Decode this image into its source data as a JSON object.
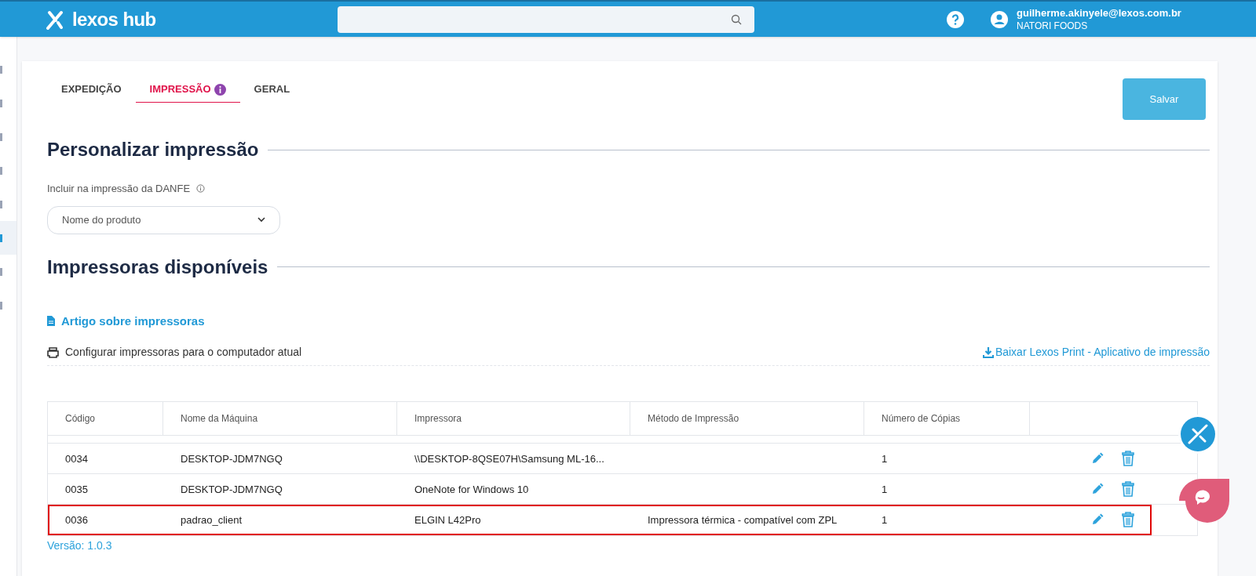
{
  "header": {
    "logo": "lexos hub",
    "user": {
      "email": "guilherme.akinyele@lexos.com.br",
      "company": "NATORI FOODS"
    }
  },
  "sidebar": {
    "items": [
      {
        "selected": false
      },
      {
        "selected": false
      },
      {
        "selected": false
      },
      {
        "selected": false
      },
      {
        "selected": false
      },
      {
        "selected": true
      },
      {
        "selected": false
      },
      {
        "selected": false
      }
    ]
  },
  "tabs": [
    {
      "label": "EXPEDIÇÃO",
      "selected": false,
      "info": false
    },
    {
      "label": "IMPRESSÃO",
      "selected": true,
      "info": true
    },
    {
      "label": "GERAL",
      "selected": false,
      "info": false
    }
  ],
  "save_button": "Salvar",
  "personalize": {
    "title": "Personalizar impressão",
    "field_label": "Incluir na impressão da DANFE",
    "select_value": "Nome do produto"
  },
  "printers": {
    "title": "Impressoras disponíveis",
    "article_link": "Artigo sobre impressoras",
    "configure": "Configurar impressoras para o computador atual",
    "download_link": "Baixar Lexos Print - Aplicativo de impressão"
  },
  "table": {
    "columns": [
      "Código",
      "Nome da Máquina",
      "Impressora",
      "Método de Impressão",
      "Número de Cópias"
    ],
    "rows": [
      {
        "cells": [
          "0034",
          "DESKTOP-JDM7NGQ",
          "\\\\DESKTOP-8QSE07H\\Samsung ML-16...",
          "",
          "1"
        ],
        "highlighted": false
      },
      {
        "cells": [
          "0035",
          "DESKTOP-JDM7NGQ",
          "OneNote for Windows 10",
          "",
          "1"
        ],
        "highlighted": false
      },
      {
        "cells": [
          "0036",
          "padrao_client",
          "ELGIN L42Pro",
          "Impressora térmica - compatível com ZPL",
          "1"
        ],
        "highlighted": true
      }
    ]
  },
  "version": "Versão: 1.0.3"
}
